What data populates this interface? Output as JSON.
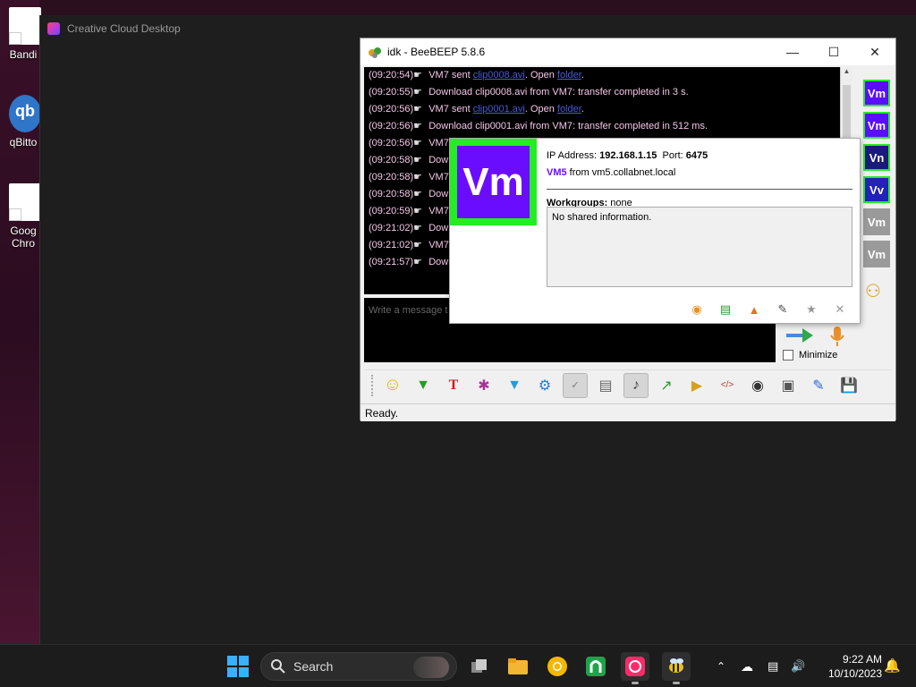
{
  "desktop": {
    "icons": [
      {
        "label": "Bandi"
      },
      {
        "label": "qBitto"
      },
      {
        "label": "Goog Chro"
      }
    ]
  },
  "cc_window": {
    "title": "Creative Cloud Desktop"
  },
  "beebeep": {
    "title": "idk - BeeBEEP 5.8.6",
    "chat_lines": [
      {
        "ts": "(09:20:54)",
        "pre": " VM7 sent ",
        "link": "clip0008.avi",
        "mid": ". Open ",
        "link2": "folder",
        "post": "."
      },
      {
        "ts": "(09:20:55)",
        "pre": " Download clip0008.avi from VM7: transfer completed in 3 s.",
        "link": "",
        "mid": "",
        "link2": "",
        "post": ""
      },
      {
        "ts": "(09:20:56)",
        "pre": " VM7 sent ",
        "link": "clip0001.avi",
        "mid": ". Open ",
        "link2": "folder",
        "post": "."
      },
      {
        "ts": "(09:20:56)",
        "pre": " Download clip0001.avi from VM7: transfer completed in 512 ms.",
        "link": "",
        "mid": "",
        "link2": "",
        "post": ""
      },
      {
        "ts": "(09:20:56)",
        "pre": " VM7",
        "link": "",
        "mid": "",
        "link2": "",
        "post": ""
      },
      {
        "ts": "(09:20:58)",
        "pre": " Dow",
        "link": "",
        "mid": "",
        "link2": "",
        "post": ""
      },
      {
        "ts": "(09:20:58)",
        "pre": " VM7",
        "link": "",
        "mid": "",
        "link2": "",
        "post": ""
      },
      {
        "ts": "(09:20:58)",
        "pre": " Dow",
        "link": "",
        "mid": "",
        "link2": "",
        "post": ""
      },
      {
        "ts": "(09:20:59)",
        "pre": " VM7",
        "link": "",
        "mid": "",
        "link2": "",
        "post": ""
      },
      {
        "ts": "(09:21:02)",
        "pre": " Dow",
        "link": "",
        "mid": "",
        "link2": "",
        "post": ""
      },
      {
        "ts": "(09:21:02)",
        "pre": " VM7",
        "link": "",
        "mid": "",
        "link2": "",
        "post": ""
      },
      {
        "ts": "(09:21:57)",
        "pre": " Dow",
        "link": "",
        "mid": "",
        "link2": "",
        "post": ""
      }
    ],
    "message_placeholder": "Write a message t",
    "minimize_label": "Minimize",
    "status": "Ready.",
    "users": [
      {
        "label": "Vm",
        "bg": "#5a0dff",
        "border": "#22ee22"
      },
      {
        "label": "Vm",
        "bg": "#5a0dff",
        "border": "#22ee22"
      },
      {
        "label": "Vn",
        "bg": "#1a1a7a",
        "border": "#22ee22"
      },
      {
        "label": "Vv",
        "bg": "#2222bb",
        "border": "#22ee22"
      },
      {
        "label": "Vm",
        "bg": "#9a9a9a",
        "border": "#9a9a9a"
      },
      {
        "label": "Vm",
        "bg": "#9a9a9a",
        "border": "#9a9a9a"
      }
    ]
  },
  "popup": {
    "avatar_text": "Vm",
    "ip_label": "IP Address:",
    "ip": "192.168.1.15",
    "port_label": "Port:",
    "port": "6475",
    "user": "VM5",
    "from": " from vm5.collabnet.local",
    "workgroups_label": "Workgroups:",
    "workgroups": " none",
    "shared": "No shared information."
  },
  "taskbar": {
    "search_label": "Search",
    "time": "9:22 AM",
    "date": "10/10/2023"
  }
}
